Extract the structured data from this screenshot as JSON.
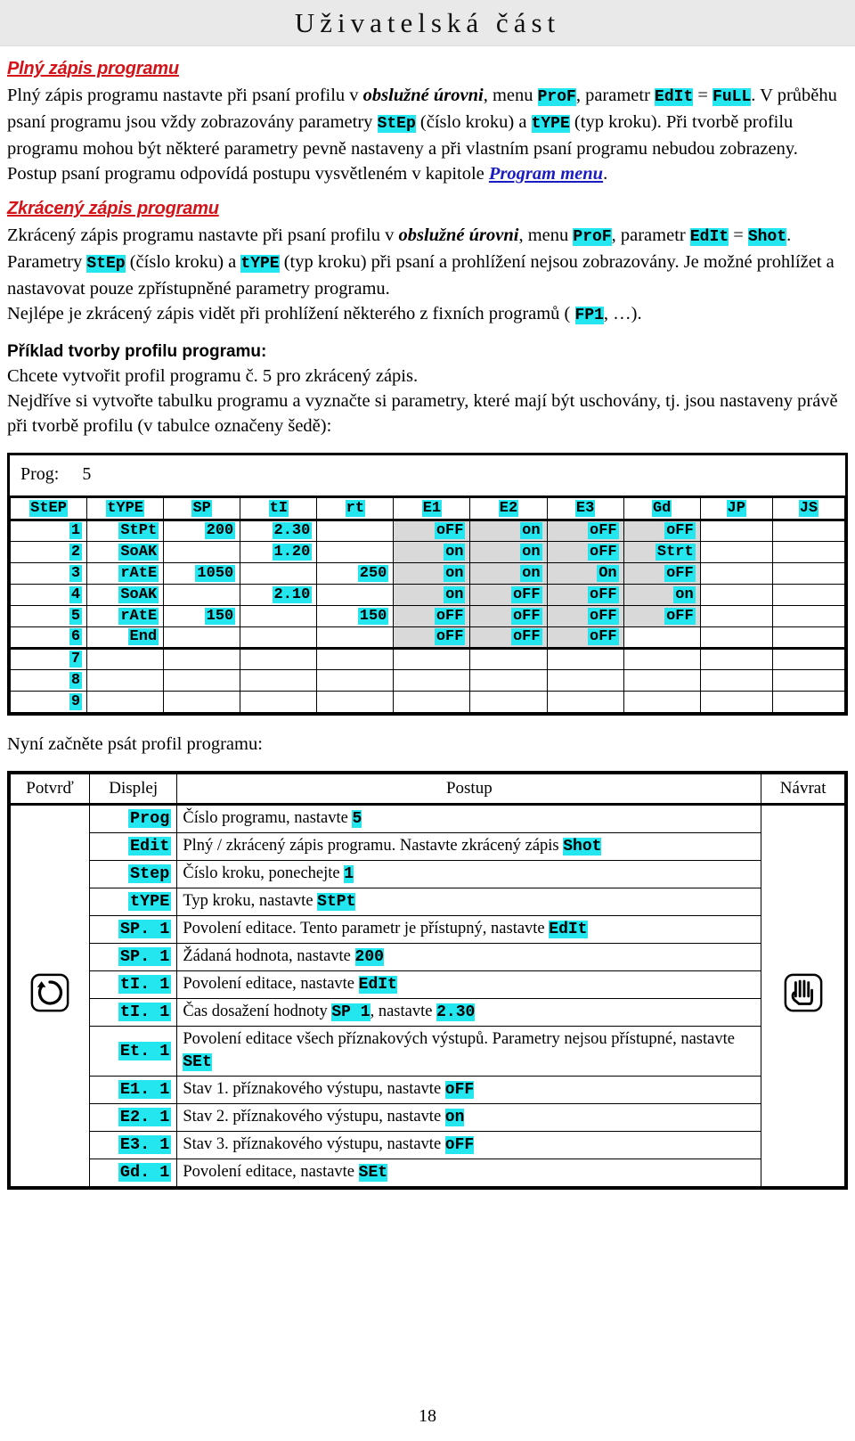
{
  "banner": {
    "title": "Uživatelská část"
  },
  "section1": {
    "heading": "Plný zápis programu",
    "t1": "Plný zápis programu nastavte při psaní profilu v ",
    "em1": "obslužné úrovni",
    "t2": ", menu ",
    "code1": "ProF",
    "t3": ", parametr ",
    "code2": "EdIt",
    "t4": " = ",
    "code3": "FuLL",
    "t5": ". V průběhu psaní programu jsou vždy zobrazovány parametry ",
    "code4": "StEp",
    "t6": " (číslo kroku) a ",
    "code5": "tYPE",
    "t7": " (typ kroku). Při tvorbě profilu programu mohou být některé parametry pevně nastaveny a při vlastním psaní programu nebudou zobrazeny. Postup psaní programu odpovídá postupu vysvětleném v kapitole ",
    "link": "Program menu",
    "t8": "."
  },
  "section2": {
    "heading": "Zkrácený zápis programu",
    "t1": "Zkrácený zápis programu nastavte při psaní profilu v ",
    "em1": "obslužné úrovni",
    "t2": ", menu ",
    "code1": "ProF",
    "t3": ", parametr ",
    "code2": "EdIt",
    "t4": " = ",
    "code3": "Shot",
    "t5": ". Parametry ",
    "code4": "StEp",
    "t6": " (číslo kroku) a ",
    "code5": "tYPE",
    "t7": " (typ kroku) při psaní a prohlížení nejsou zobrazovány. Je možné prohlížet a nastavovat pouze zpřístupněné parametry programu.",
    "t8": "Nejlépe je zkrácený zápis vidět při prohlížení některého z fixních programů ( ",
    "code6": "FP1",
    "t9": ", …)."
  },
  "section3": {
    "heading": "Příklad tvorby profilu programu:",
    "t1": "Chcete vytvořit profil programu č. 5 pro zkrácený zápis.",
    "t2": "Nejdříve si vytvořte tabulku programu a vyznačte si parametry, které mají být uschovány, tj. jsou nastaveny právě při tvorbě profilu (v tabulce označeny šedě):"
  },
  "prog_table": {
    "label": "Prog:",
    "value": "5",
    "columns": [
      "StEP",
      "tYPE",
      "SP",
      "tI",
      "rt",
      "E1",
      "E2",
      "E3",
      "Gd",
      "JP",
      "JS"
    ],
    "rows": [
      {
        "step": "1",
        "type": "StPt",
        "sp": "200",
        "ti": "2.30",
        "rt": "",
        "e1": "oFF",
        "e2": "on",
        "e3": "oFF",
        "gd": "oFF",
        "jp": "",
        "js": ""
      },
      {
        "step": "2",
        "type": "SoAK",
        "sp": "",
        "ti": "1.20",
        "rt": "",
        "e1": "on",
        "e2": "on",
        "e3": "oFF",
        "gd": "Strt",
        "jp": "",
        "js": ""
      },
      {
        "step": "3",
        "type": "rAtE",
        "sp": "1050",
        "ti": "",
        "rt": "250",
        "e1": "on",
        "e2": "on",
        "e3": "On",
        "gd": "oFF",
        "jp": "",
        "js": ""
      },
      {
        "step": "4",
        "type": "SoAK",
        "sp": "",
        "ti": "2.10",
        "rt": "",
        "e1": "on",
        "e2": "oFF",
        "e3": "oFF",
        "gd": "on",
        "jp": "",
        "js": ""
      },
      {
        "step": "5",
        "type": "rAtE",
        "sp": "150",
        "ti": "",
        "rt": "150",
        "e1": "oFF",
        "e2": "oFF",
        "e3": "oFF",
        "gd": "oFF",
        "jp": "",
        "js": ""
      },
      {
        "step": "6",
        "type": "End",
        "sp": "",
        "ti": "",
        "rt": "",
        "e1": "oFF",
        "e2": "oFF",
        "e3": "oFF",
        "gd": "",
        "jp": "",
        "js": ""
      },
      {
        "step": "7",
        "type": "",
        "sp": "",
        "ti": "",
        "rt": "",
        "e1": "",
        "e2": "",
        "e3": "",
        "gd": "",
        "jp": "",
        "js": ""
      },
      {
        "step": "8",
        "type": "",
        "sp": "",
        "ti": "",
        "rt": "",
        "e1": "",
        "e2": "",
        "e3": "",
        "gd": "",
        "jp": "",
        "js": ""
      },
      {
        "step": "9",
        "type": "",
        "sp": "",
        "ti": "",
        "rt": "",
        "e1": "",
        "e2": "",
        "e3": "",
        "gd": "",
        "jp": "",
        "js": ""
      }
    ]
  },
  "midtext": "Nyní začněte psát profil programu:",
  "instr_table": {
    "headers": [
      "Potvrď",
      "Displej",
      "Postup",
      "Návrat"
    ],
    "confirm_icon": "loop-arrow-icon",
    "return_icon": "hand-icon",
    "rows": [
      {
        "display": "Prog",
        "pre": "Číslo programu, nastavte ",
        "code": "5",
        "post": ""
      },
      {
        "display": "Edit",
        "pre": "Plný / zkrácený zápis programu. Nastavte zkrácený zápis ",
        "code": "Shot",
        "post": ""
      },
      {
        "display": "Step",
        "pre": "Číslo kroku, ponechejte ",
        "code": "1",
        "post": ""
      },
      {
        "display": "tYPE",
        "pre": "Typ kroku, nastavte ",
        "code": "StPt",
        "post": ""
      },
      {
        "display": "SP. 1",
        "pre": "Povolení editace. Tento parametr je přístupný, nastavte ",
        "code": "EdIt",
        "post": ""
      },
      {
        "display": "SP. 1",
        "pre": "Žádaná hodnota, nastavte ",
        "code": "200",
        "post": ""
      },
      {
        "display": "tI. 1",
        "pre": "Povolení editace, nastavte ",
        "code": "EdIt",
        "post": ""
      },
      {
        "display": "tI. 1",
        "pre": "Čas dosažení hodnoty ",
        "code": "SP 1",
        "mid": ", nastavte ",
        "code2": "2.30",
        "post": ""
      },
      {
        "display": "Et. 1",
        "pre": "Povolení editace všech příznakových výstupů. Parametry nejsou přístupné, nastavte ",
        "code": "SEt",
        "post": ""
      },
      {
        "display": "E1. 1",
        "pre": "Stav 1. příznakového výstupu, nastavte ",
        "code": "oFF",
        "post": ""
      },
      {
        "display": "E2. 1",
        "pre": "Stav 2. příznakového výstupu, nastavte ",
        "code": "on",
        "post": ""
      },
      {
        "display": "E3. 1",
        "pre": "Stav 3. příznakového výstupu, nastavte ",
        "code": "oFF",
        "post": ""
      },
      {
        "display": "Gd. 1",
        "pre": "Povolení editace, nastavte ",
        "code": "SEt",
        "post": ""
      }
    ]
  },
  "page_number": "18",
  "colors": {
    "highlight": "#23e6ef",
    "heading_red": "#d41217",
    "link_blue": "#1b1bc4",
    "gray_cell": "#d9d9d9",
    "banner_bg": "#e9e9e9"
  }
}
